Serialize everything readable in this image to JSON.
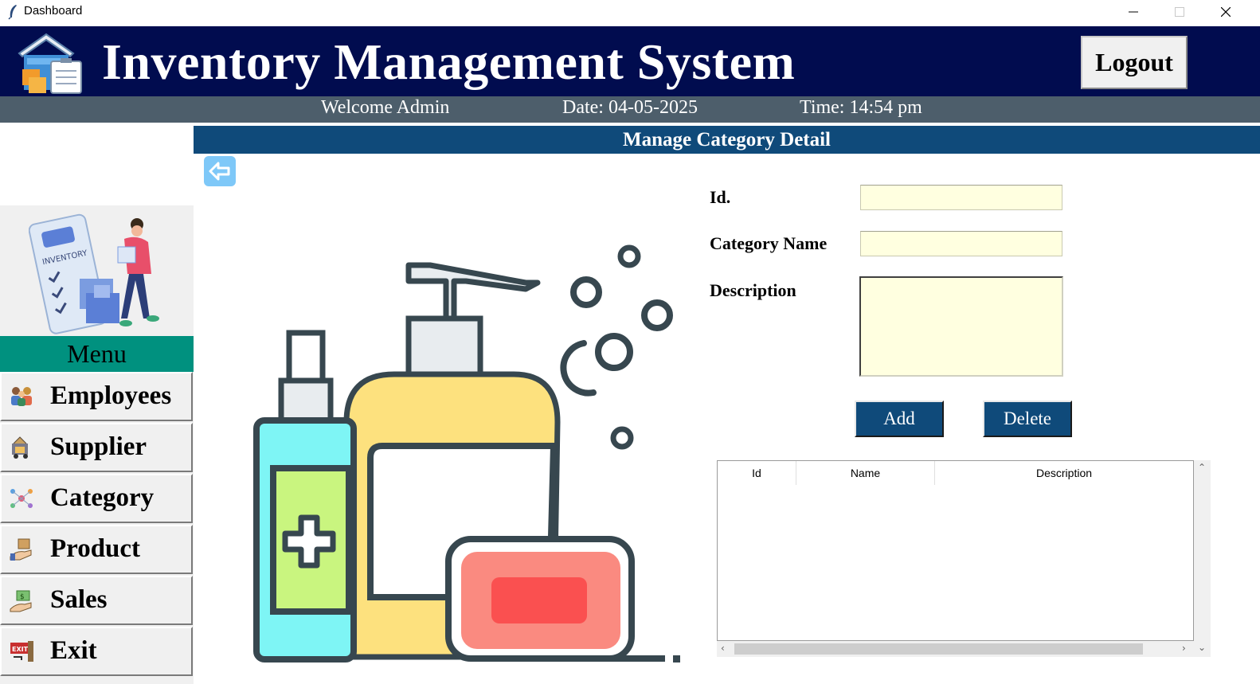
{
  "window": {
    "title": "Dashboard"
  },
  "header": {
    "title": "Inventory Management System",
    "logout_label": "Logout",
    "welcome": "Welcome Admin",
    "date": "Date: 04-05-2025",
    "time": "Time: 14:54 pm"
  },
  "menu": {
    "title": "Menu",
    "items": [
      {
        "label": "Employees",
        "icon": "employees-icon"
      },
      {
        "label": "Supplier",
        "icon": "supplier-truck-icon"
      },
      {
        "label": "Category",
        "icon": "category-network-icon"
      },
      {
        "label": "Product",
        "icon": "product-hand-box-icon"
      },
      {
        "label": "Sales",
        "icon": "sales-money-icon"
      },
      {
        "label": "Exit",
        "icon": "exit-sign-icon"
      }
    ]
  },
  "page": {
    "heading": "Manage Category Detail",
    "back_icon": "back-arrow-icon"
  },
  "form": {
    "id_label": "Id.",
    "id_value": "",
    "name_label": "Category Name",
    "name_value": "",
    "description_label": "Description",
    "description_value": "",
    "add_label": "Add",
    "delete_label": "Delete"
  },
  "table": {
    "columns": [
      "Id",
      "Name",
      "Description"
    ],
    "rows": []
  },
  "colors": {
    "header_bg": "#010c4f",
    "infobar_bg": "#4d5e6b",
    "content_bar_bg": "#0f4a7a",
    "menu_title_bg": "#00917f",
    "input_bg": "#ffffe0",
    "button_bg": "#0f4a7a"
  }
}
